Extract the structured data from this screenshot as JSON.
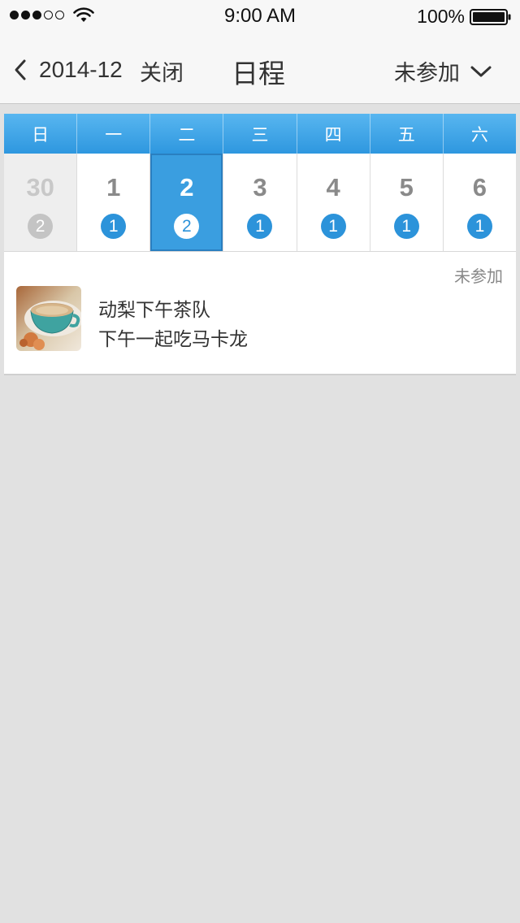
{
  "status_bar": {
    "time": "9:00 AM",
    "battery_percent": "100%"
  },
  "nav": {
    "back_label": "2014-12",
    "close_label": "关闭",
    "title": "日程",
    "filter_label": "未参加"
  },
  "calendar": {
    "weekdays": [
      "日",
      "一",
      "二",
      "三",
      "四",
      "五",
      "六"
    ],
    "days": [
      {
        "date": "30",
        "count": "2",
        "state": "other-month"
      },
      {
        "date": "1",
        "count": "1",
        "state": "normal"
      },
      {
        "date": "2",
        "count": "2",
        "state": "selected"
      },
      {
        "date": "3",
        "count": "1",
        "state": "normal"
      },
      {
        "date": "4",
        "count": "1",
        "state": "normal"
      },
      {
        "date": "5",
        "count": "1",
        "state": "normal"
      },
      {
        "date": "6",
        "count": "1",
        "state": "normal"
      }
    ]
  },
  "event": {
    "status": "未参加",
    "title": "动梨下午茶队",
    "description": "下午一起吃马卡龙"
  },
  "colors": {
    "accent": "#2c93da",
    "header_gradient_top": "#58b6f0",
    "header_gradient_bottom": "#2e97df",
    "background": "#e1e1e1"
  }
}
